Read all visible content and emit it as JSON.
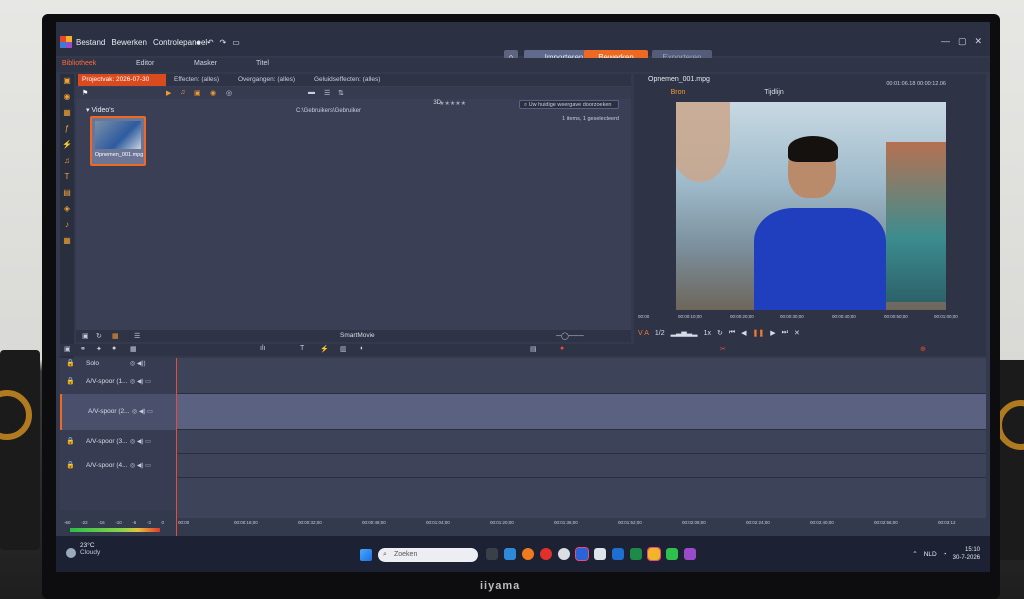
{
  "app": {
    "menu": [
      "Bestand",
      "Bewerken",
      "Controlepaneel"
    ],
    "top_tabs": {
      "import": "Importeren",
      "edit": "Bewerken",
      "export": "Exporteren"
    }
  },
  "library_tabs": {
    "library": "Bibliotheek",
    "editor": "Editor",
    "mask": "Masker",
    "title": "Titel"
  },
  "library": {
    "tabs": [
      "Projectvak: 2026-07-30",
      "Effecten: (alles)",
      "Overgangen: (alles)",
      "Geluidseffecten: (alles)"
    ],
    "folder": "Video's",
    "path": "C:\\Gebruikers\\Gebruiker",
    "search_placeholder": "Uw huidige weergave doorzoeken",
    "count_text": "1 items, 1 geselecteerd",
    "label_3d": "3D",
    "stars": "★★★★★",
    "clip_name": "Opnemen_001.mpg",
    "smart_movie": "SmartMovie"
  },
  "preview": {
    "filename": "Opnemen_001.mpg",
    "timecode_1": "00:01:06.18",
    "timecode_2": "00:00:12.06",
    "tab_source": "Bron",
    "tab_timeline": "Tijdlijn",
    "ruler": [
      "00:00",
      "00:00:10;00",
      "00:00:20;00",
      "00:00:30;00",
      "00:00:40;00",
      "00:00:50;00",
      "00:01:00;00"
    ],
    "ratio": "1/2",
    "speed": "1x"
  },
  "timeline": {
    "solo": "Solo",
    "tracks": [
      "A/V-spoor (1...",
      "A/V-spoor (2...",
      "A/V-spoor (3...",
      "A/V-spoor (4..."
    ],
    "ruler": [
      "00:00",
      "00:00:16;00",
      "00:00:32;00",
      "00:00:48;00",
      "00:01:04;00",
      "00:01:20;00",
      "00:01:36;00",
      "00:01:52;00",
      "00:02:08;00",
      "00:02:24;00",
      "00:02:40;00",
      "00:02:56;00",
      "00:03:12"
    ],
    "vu_scale": [
      "-60",
      "-22",
      "-16",
      "-10",
      "-6",
      "-3",
      "0"
    ]
  },
  "taskbar": {
    "temp": "23°C",
    "condition": "Cloudy",
    "search": "Zoeken",
    "lang": "NLD",
    "time": "15:10",
    "date": "30-7-2026"
  },
  "monitor_brand": "iiyama"
}
